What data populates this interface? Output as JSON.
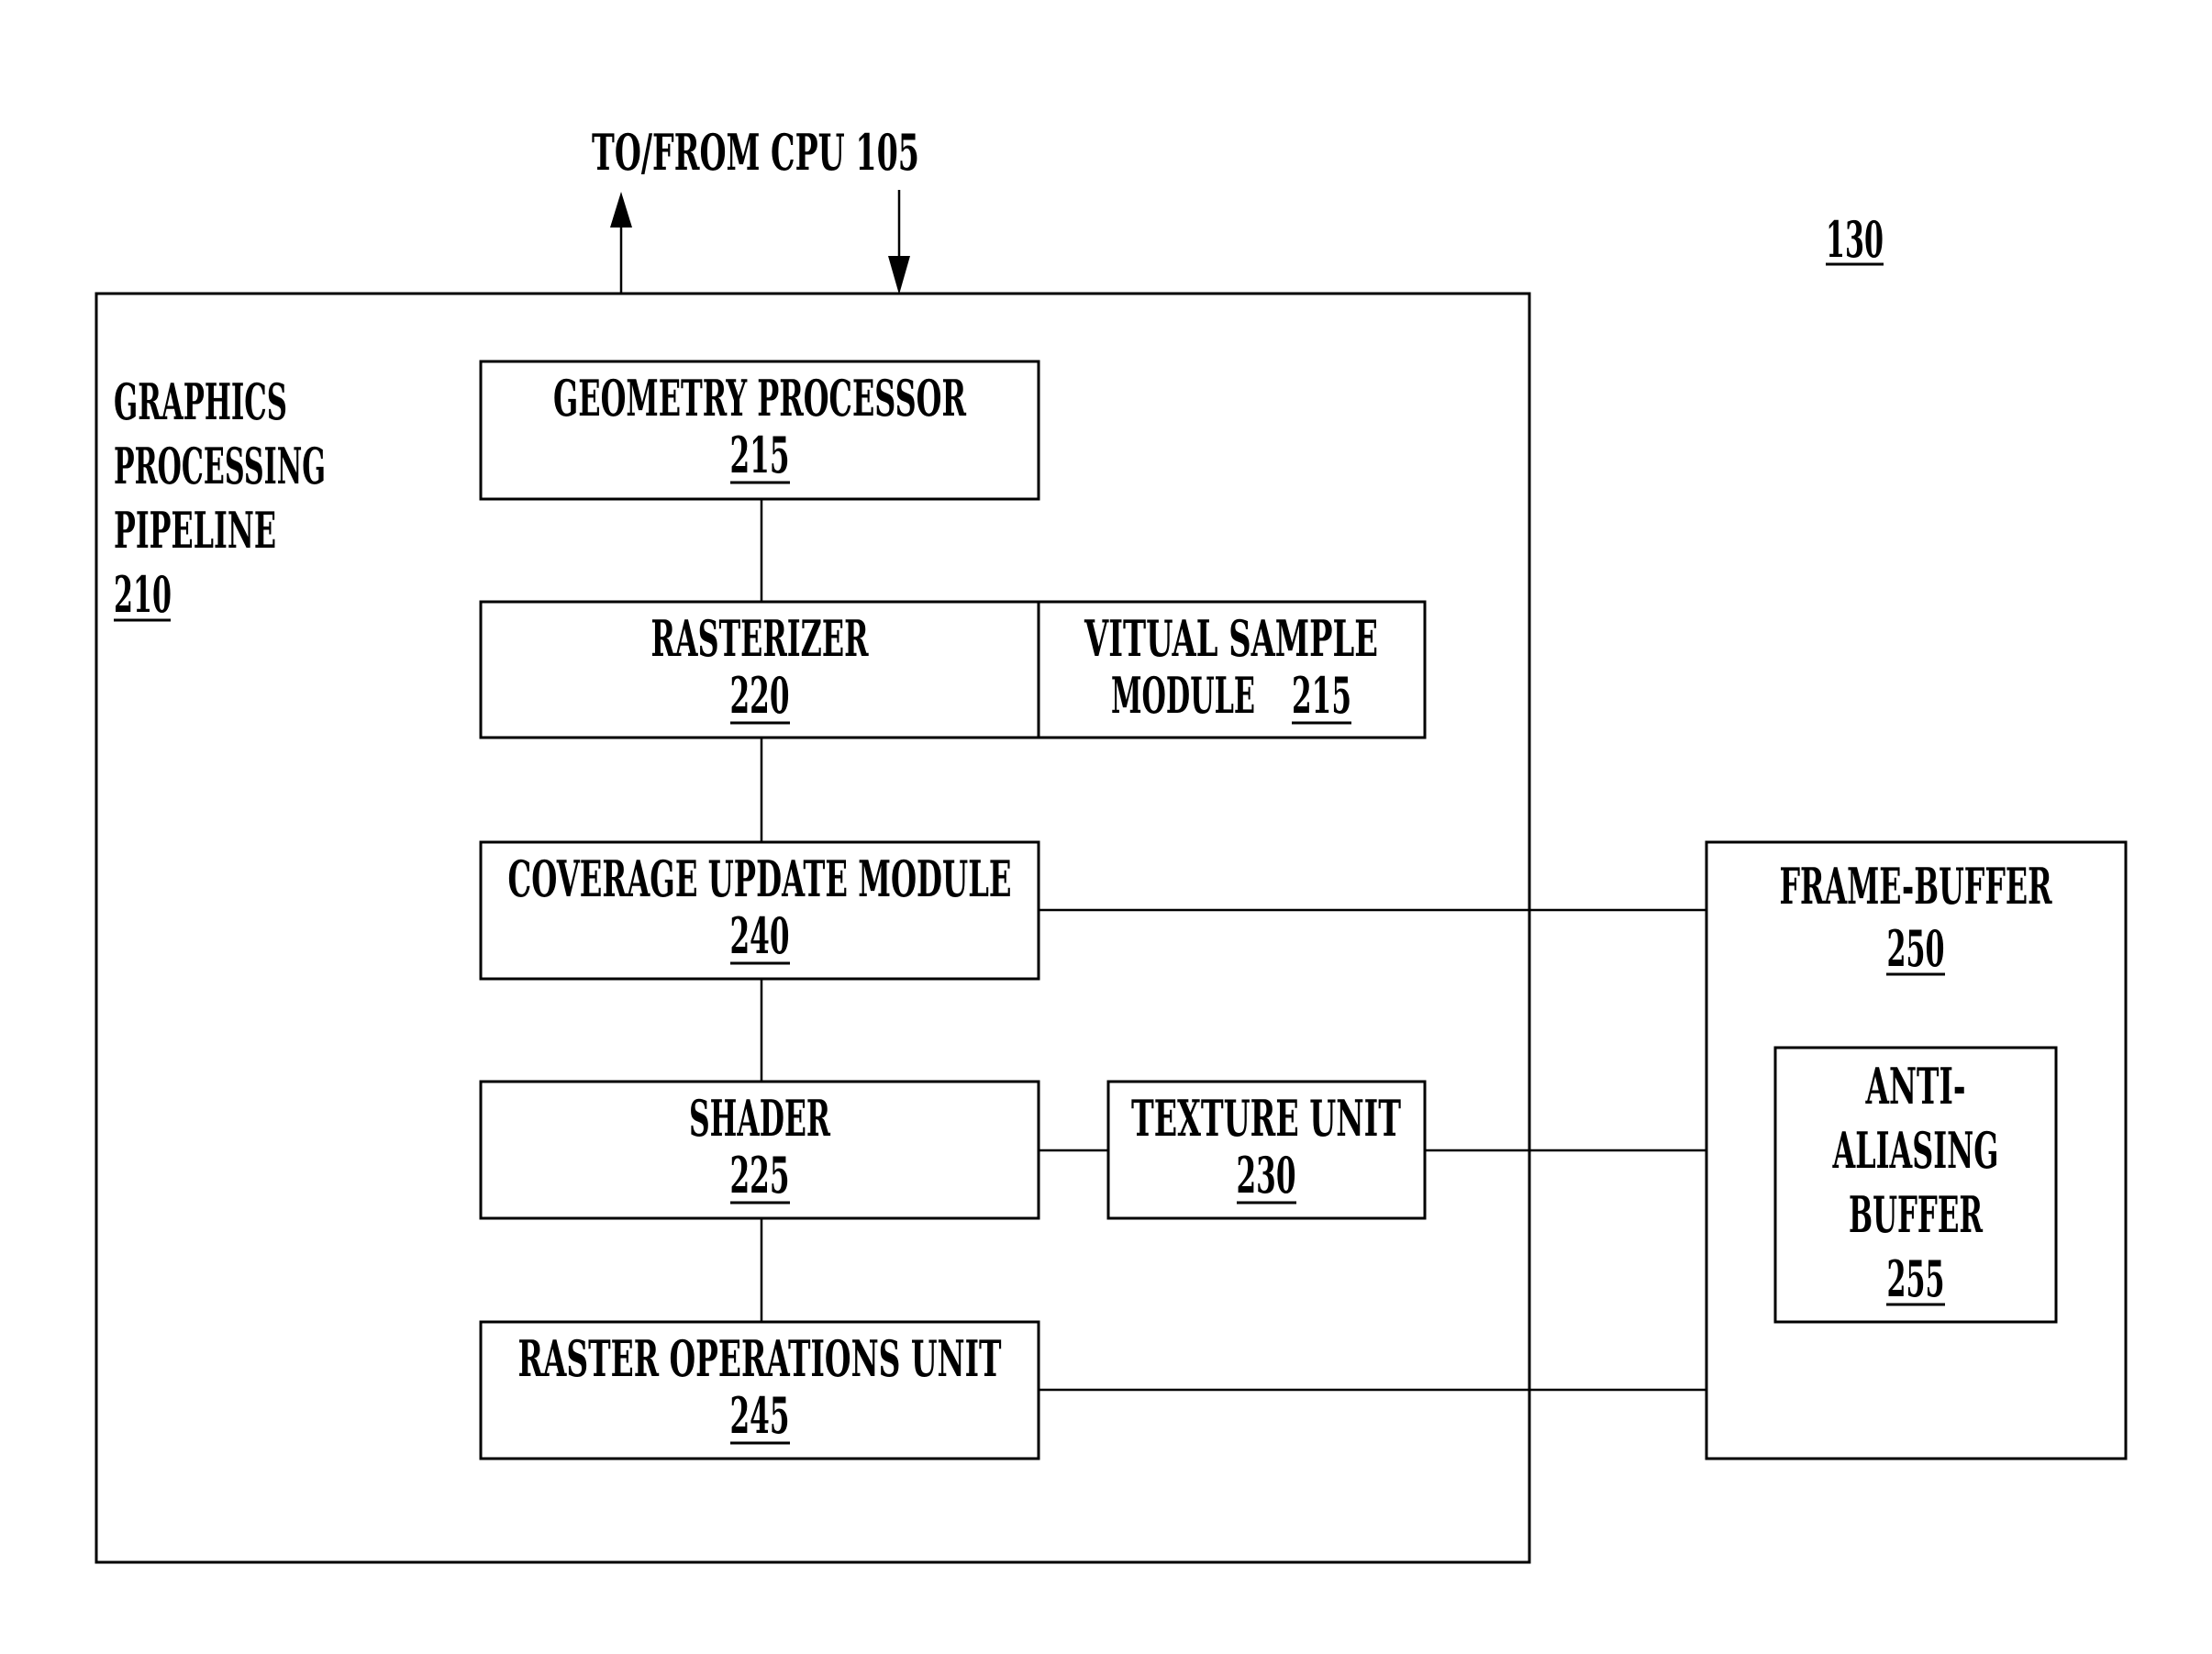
{
  "figure": {
    "reference_numeral": "130",
    "cpu_link": {
      "label": "TO/FROM CPU 105",
      "arrows": [
        "to-cpu",
        "from-cpu"
      ]
    },
    "pipeline": {
      "title_lines": [
        "GRAPHICS",
        "PROCESSING",
        "PIPELINE"
      ],
      "numeral": "210"
    },
    "blocks": {
      "geometry": {
        "label": "GEOMETRY PROCESSOR",
        "numeral": "215"
      },
      "rasterizer": {
        "label": "RASTERIZER",
        "numeral": "220"
      },
      "virtual_sample": {
        "label_lines": [
          "VITUAL SAMPLE",
          "MODULE"
        ],
        "numeral": "215"
      },
      "coverage": {
        "label": "COVERAGE UPDATE MODULE",
        "numeral": "240"
      },
      "shader": {
        "label": "SHADER",
        "numeral": "225"
      },
      "texture": {
        "label": "TEXTURE UNIT",
        "numeral": "230"
      },
      "rop": {
        "label": "RASTER OPERATIONS UNIT",
        "numeral": "245"
      },
      "frame_buffer": {
        "label": "FRAME-BUFFER",
        "numeral": "250"
      },
      "aa_buffer": {
        "label_lines": [
          "ANTI-",
          "ALIASING",
          "BUFFER"
        ],
        "numeral": "255"
      }
    },
    "connections": [
      [
        "geometry",
        "rasterizer"
      ],
      [
        "rasterizer",
        "coverage"
      ],
      [
        "coverage",
        "shader"
      ],
      [
        "shader",
        "rop"
      ],
      [
        "shader",
        "texture"
      ],
      [
        "coverage",
        "frame_buffer"
      ],
      [
        "texture",
        "frame_buffer"
      ],
      [
        "rop",
        "frame_buffer"
      ]
    ]
  }
}
